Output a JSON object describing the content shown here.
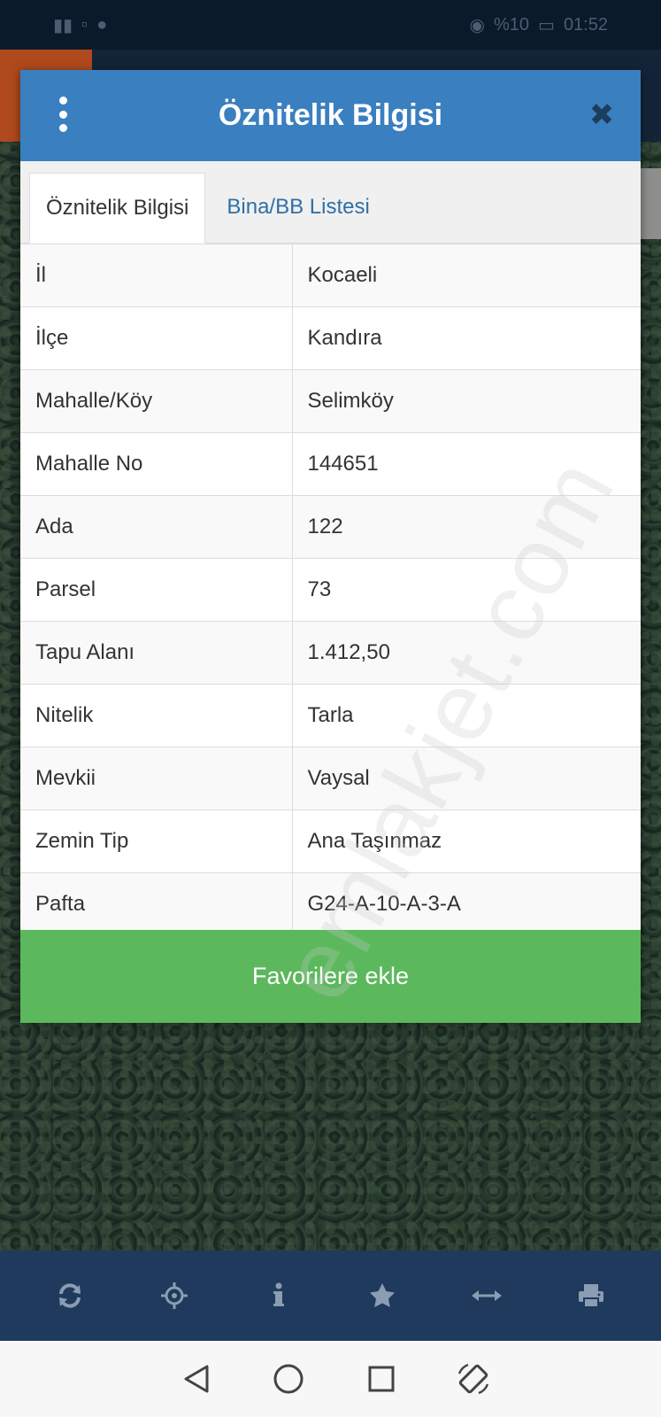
{
  "status_bar": {
    "battery_text": "%10",
    "time": "01:52"
  },
  "dialog": {
    "title": "Öznitelik Bilgisi",
    "tabs": [
      {
        "label": "Öznitelik Bilgisi",
        "active": true
      },
      {
        "label": "Bina/BB Listesi",
        "active": false
      }
    ],
    "rows": [
      {
        "key": "İl",
        "value": "Kocaeli"
      },
      {
        "key": "İlçe",
        "value": "Kandıra"
      },
      {
        "key": "Mahalle/Köy",
        "value": "Selimköy"
      },
      {
        "key": "Mahalle No",
        "value": "144651"
      },
      {
        "key": "Ada",
        "value": "122"
      },
      {
        "key": "Parsel",
        "value": "73"
      },
      {
        "key": "Tapu Alanı",
        "value": "1.412,50"
      },
      {
        "key": "Nitelik",
        "value": "Tarla"
      },
      {
        "key": "Mevkii",
        "value": "Vaysal"
      },
      {
        "key": "Zemin Tip",
        "value": "Ana Taşınmaz"
      },
      {
        "key": "Pafta",
        "value": "G24-A-10-A-3-A"
      }
    ],
    "favorite_button": "Favorilere ekle"
  },
  "watermark": "emlakjet.com",
  "toolbar_icons": [
    "refresh-icon",
    "crosshair-icon",
    "info-icon",
    "star-icon",
    "measure-icon",
    "print-icon"
  ],
  "colors": {
    "header": "#3a7fc0",
    "favorite": "#5cb85c",
    "toolbar": "#1f3a5c",
    "tab_link": "#2f6fa8"
  }
}
